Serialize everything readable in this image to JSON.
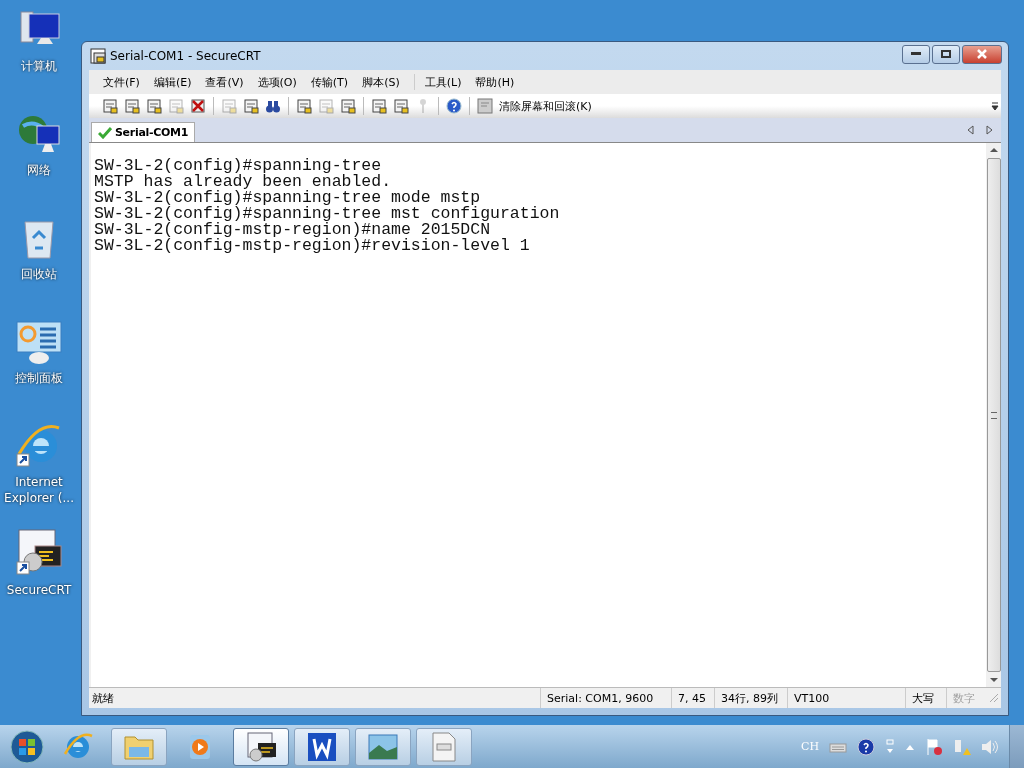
{
  "desktop_icons": [
    {
      "kind": "computer",
      "label": "计算机"
    },
    {
      "kind": "network",
      "label": "网络"
    },
    {
      "kind": "recycle",
      "label": "回收站"
    },
    {
      "kind": "panel",
      "label": "控制面板"
    },
    {
      "kind": "browser",
      "label": "Internet Explorer (..."
    },
    {
      "kind": "terminal",
      "label": "SecureCRT"
    }
  ],
  "window": {
    "title": "Serial-COM1 - SecureCRT"
  },
  "menu": [
    "文件(F)",
    "编辑(E)",
    "查看(V)",
    "选项(O)",
    "传输(T)",
    "脚本(S)",
    "工具(L)",
    "帮助(H)"
  ],
  "toolbar": [
    {
      "kind": "icon",
      "disabled": false
    },
    {
      "kind": "icon",
      "disabled": false
    },
    {
      "kind": "icon",
      "disabled": false
    },
    {
      "kind": "icon",
      "disabled": true
    },
    {
      "kind": "disconnect",
      "disabled": false
    },
    {
      "kind": "separator"
    },
    {
      "kind": "icon",
      "disabled": true
    },
    {
      "kind": "icon",
      "disabled": false
    },
    {
      "kind": "find",
      "disabled": false
    },
    {
      "kind": "separator"
    },
    {
      "kind": "icon",
      "disabled": false
    },
    {
      "kind": "icon",
      "disabled": true
    },
    {
      "kind": "icon",
      "disabled": false
    },
    {
      "kind": "separator"
    },
    {
      "kind": "icon",
      "disabled": false
    },
    {
      "kind": "icon",
      "disabled": false
    },
    {
      "kind": "key",
      "disabled": true
    },
    {
      "kind": "separator"
    },
    {
      "kind": "help",
      "disabled": false
    },
    {
      "kind": "separator"
    },
    {
      "kind": "text",
      "label": "清除屏幕和回滚(K)",
      "disabled": false
    }
  ],
  "tabs": [
    {
      "label": "Serial-COM1",
      "selected": true,
      "connected": true
    }
  ],
  "terminal": {
    "lines": [
      "SW-3L-2(config)#spanning-tree",
      "MSTP has already been enabled.",
      "SW-3L-2(config)#spanning-tree mode mstp",
      "SW-3L-2(config)#spanning-tree mst configuration",
      "SW-3L-2(config-mstp-region)#name 2015DCN",
      "SW-3L-2(config-mstp-region)#revision-level 1"
    ]
  },
  "status_bar": {
    "message": "就绪",
    "fields": [
      {
        "text": "Serial: COM1, 9600",
        "disabled": false
      },
      {
        "text": "7,  45",
        "disabled": false
      },
      {
        "text": "34行, 89列",
        "disabled": false
      },
      {
        "text": "VT100",
        "disabled": false
      },
      {
        "text": "大写",
        "disabled": false
      },
      {
        "text": "数字",
        "disabled": true
      }
    ]
  },
  "taskbar": {
    "items": [
      {
        "kind": "browser",
        "selected": false
      },
      {
        "kind": "folder",
        "selected": false
      },
      {
        "kind": "media",
        "selected": false
      },
      {
        "kind": "terminal",
        "selected": true
      },
      {
        "kind": "letter",
        "selected": false
      },
      {
        "kind": "picture",
        "selected": false
      },
      {
        "kind": "notepad",
        "selected": false
      }
    ],
    "language": "CH"
  }
}
